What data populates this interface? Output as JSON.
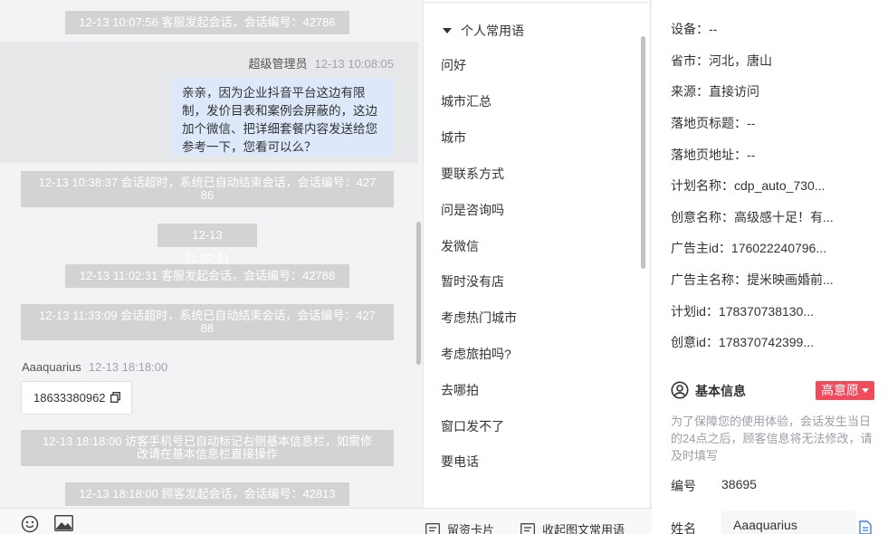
{
  "chat": {
    "system_messages": [
      "12-13 10:07:56 客服发起会话，会话编号：42786",
      "12-13 10:38:37 会话超时，系统已自动结束会话，会话编号：427",
      "86",
      "12-13 11:02:31",
      "12-13 11:02:31 客服发起会话，会话编号：42788",
      "12-13 11:33:09 会话超时，系统已自动结束会话，会话编号：427",
      "88",
      "12-13 18:18:00 访客手机号已自动标记右侧基本信息栏，如需修",
      "改请在基本信息栏直接操作",
      "12-13 18:18:00 顾客发起会话，会话编号：42813"
    ],
    "agent_message": {
      "name": "超级管理员",
      "time": "12-13 10:08:05",
      "text": "亲亲，因为企业抖音平台这边有限制，发价目表和案例会屏蔽的，这边加个微信、把详细套餐内容发送给您参考一下，您看可以么？"
    },
    "visitor_message": {
      "name": "Aaaquarius",
      "time": "12-13 18:18:00",
      "text": "18633380962"
    }
  },
  "bottom_bar": {
    "emoji_icon": "smile-icon",
    "image_icon": "image-icon",
    "card_label": "留资卡片",
    "collapse_label": "收起图文常用语"
  },
  "phrases": {
    "header": "个人常用语",
    "items": [
      "问好",
      "城市汇总",
      "城市",
      "要联系方式",
      "问是咨询吗",
      "发微信",
      "暂时没有店",
      "考虑热门城市",
      "考虑旅拍吗?",
      "去哪拍",
      "窗口发不了",
      "要电话"
    ]
  },
  "info": {
    "fields": [
      {
        "label": "设备：",
        "value": "--"
      },
      {
        "label": "省市：",
        "value": "河北，唐山"
      },
      {
        "label": "来源：",
        "value": "直接访问"
      },
      {
        "label": "落地页标题：",
        "value": "--"
      },
      {
        "label": "落地页地址：",
        "value": "--"
      },
      {
        "label": "计划名称：",
        "value": "cdp_auto_730..."
      },
      {
        "label": "创意名称：",
        "value": "高级感十足！有..."
      },
      {
        "label": "广告主id：",
        "value": "176022240796..."
      },
      {
        "label": "广告主名称：",
        "value": "提米映画婚前..."
      },
      {
        "label": "计划id：",
        "value": "178370738130..."
      },
      {
        "label": "创意id：",
        "value": "178370742399..."
      }
    ],
    "basic_title": "基本信息",
    "intent_badge": "高意愿",
    "note": "为了保障您的使用体验，会话发生当日的24点之后，顾客信息将无法修改，请及时填写",
    "number_label": "编号",
    "number_value": "38695",
    "name_label": "姓名",
    "name_value": "Aaaquarius",
    "colors": {
      "accent": "#f04a5b",
      "bubble": "#dde9fb",
      "system": "#d3d3d3"
    }
  }
}
